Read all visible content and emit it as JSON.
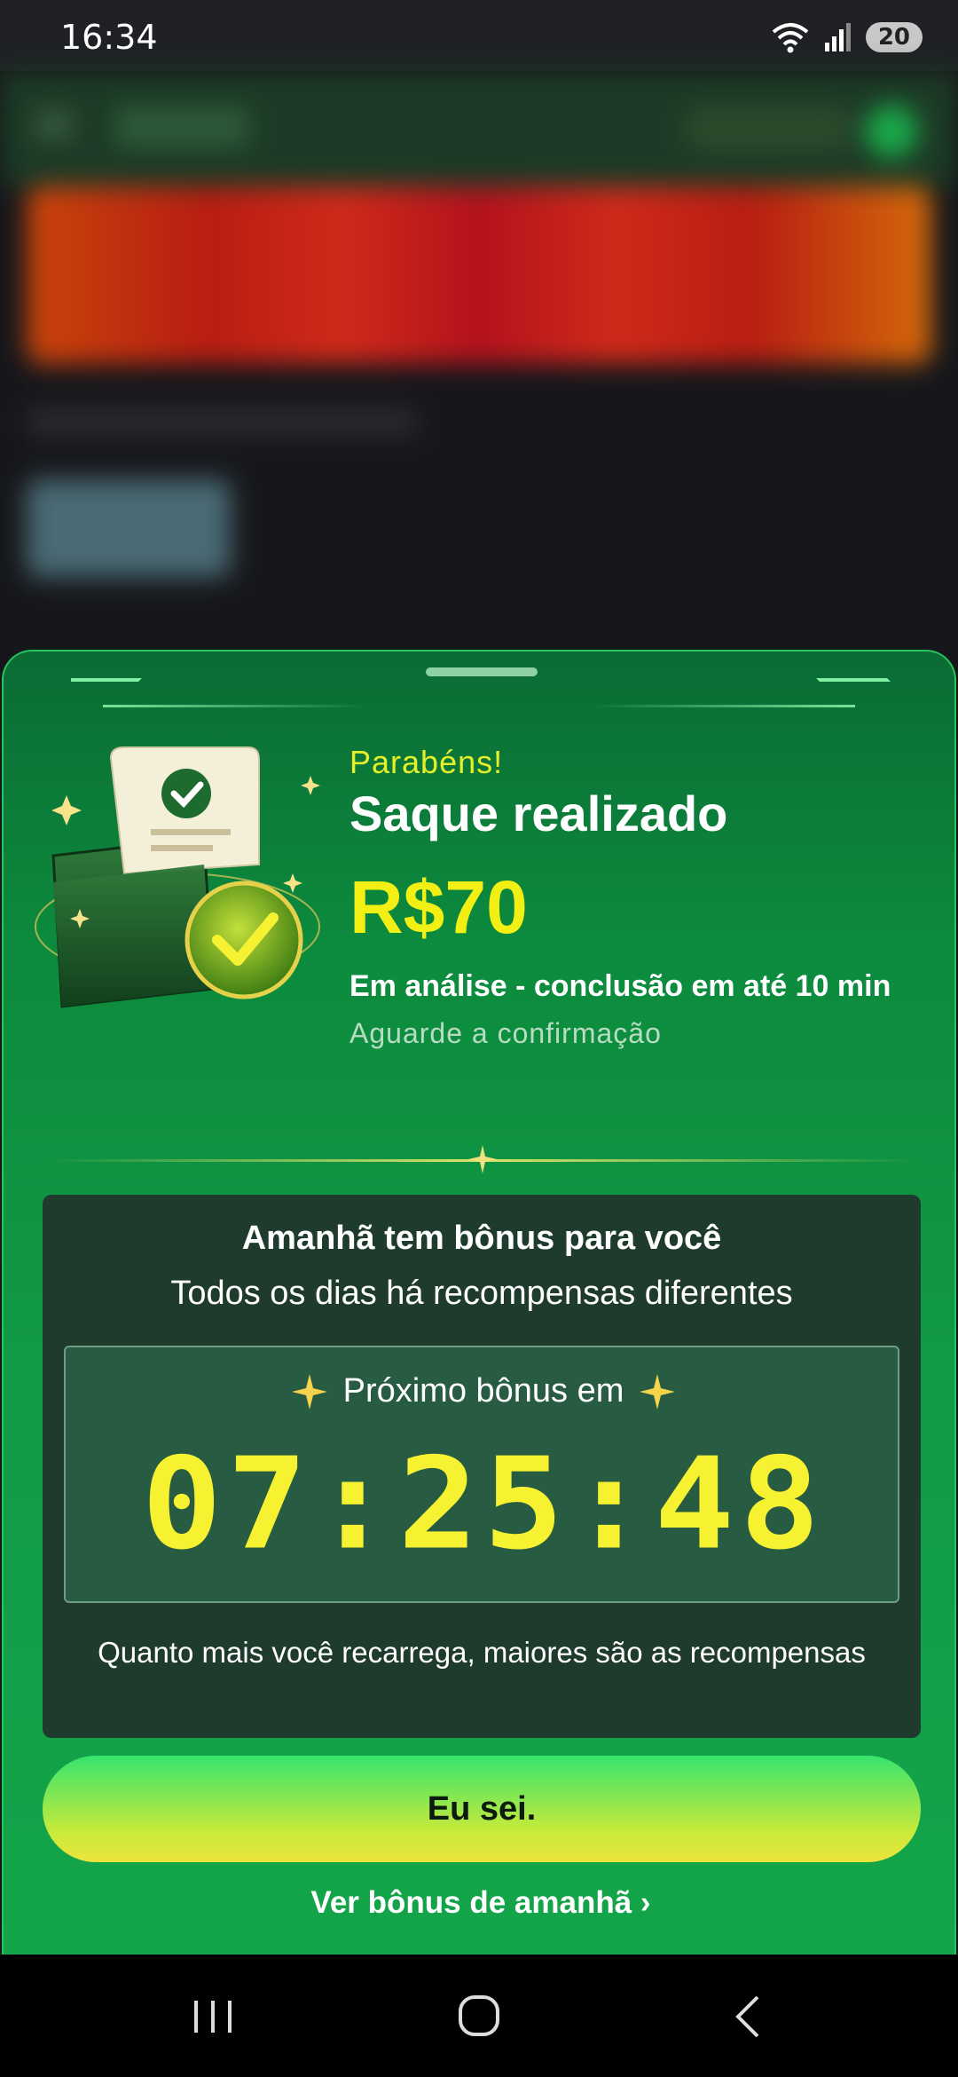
{
  "status_bar": {
    "time": "16:34",
    "battery": "20",
    "wifi_icon": "wifi-icon",
    "signal_icon": "signal-icon"
  },
  "sheet": {
    "congrats": "Parabéns!",
    "title": "Saque realizado",
    "amount": "R$70",
    "analysis": "Em análise - conclusão em até 10 min",
    "wait": "Aguarde a confirmação",
    "bonus": {
      "title": "Amanhã tem bônus para você",
      "subtitle": "Todos os dias há recompensas diferentes",
      "next_label": "Próximo bônus em",
      "timer": "07:25:48",
      "note": "Quanto mais você recarrega, maiores são as recompensas"
    },
    "cta_label": "Eu sei.",
    "link_label": "Ver bônus de amanhã",
    "link_chevron": "›"
  },
  "colors": {
    "accent_green": "#13a54a",
    "amount_yellow": "#f2ef15",
    "timer_yellow": "#f6f232",
    "box_dark": "#1f3b2d"
  }
}
